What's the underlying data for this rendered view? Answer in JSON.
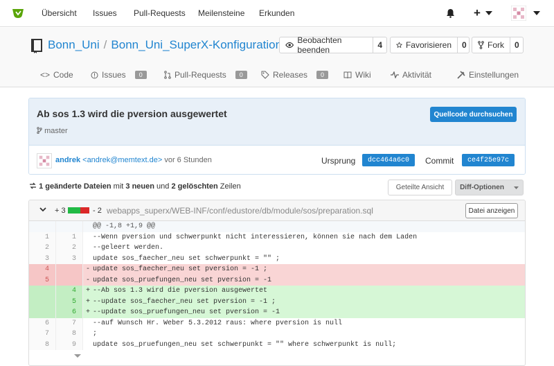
{
  "nav": {
    "items": [
      "Übersicht",
      "Issues",
      "Pull-Requests",
      "Meilensteine",
      "Erkunden"
    ],
    "plus_label": "+"
  },
  "repo": {
    "owner": "Bonn_Uni",
    "name": "Bonn_Uni_SuperX-Konfiguration",
    "watch_label": "Beobachten beenden",
    "watch_count": "4",
    "star_label": "Favorisieren",
    "star_count": "0",
    "fork_label": "Fork",
    "fork_count": "0"
  },
  "tabs": [
    {
      "label": "Code"
    },
    {
      "label": "Issues",
      "badge": "0"
    },
    {
      "label": "Pull-Requests",
      "badge": "0"
    },
    {
      "label": "Releases",
      "badge": "0"
    },
    {
      "label": "Wiki"
    },
    {
      "label": "Aktivität"
    },
    {
      "label": "Einstellungen"
    }
  ],
  "commit": {
    "title": "Ab sos 1.3 wird die pversion ausgewertet",
    "branch": "master",
    "browse_label": "Quellcode durchsuchen",
    "author_name": "andrek",
    "author_email": "<andrek@memtext.de>",
    "time": "vor 6 Stunden",
    "parent_label": "Ursprung",
    "parent_sha": "dcc464a6c0",
    "commit_label": "Commit",
    "commit_sha": "ce4f25e97c"
  },
  "stats": {
    "files": "1 geänderte Dateien",
    "mid1": " mit ",
    "added": "3 neuen",
    "mid2": " und ",
    "removed": "2 gelöschten",
    "tail": " Zeilen"
  },
  "buttons": {
    "split_label": "Geteilte Ansicht",
    "diff_options_label": "Diff-Optionen"
  },
  "file": {
    "additions": "+ 3",
    "deletions": "- 2",
    "path": "webapps_superx/WEB-INF/conf/edustore/db/module/sos/preparation.sql",
    "view_label": "Datei anzeigen"
  },
  "diff": [
    {
      "type": "hunk",
      "old": "",
      "new": "",
      "sign": "",
      "text": "@@ -1,8 +1,9 @@"
    },
    {
      "type": "ctx",
      "old": "1",
      "new": "1",
      "sign": "",
      "text": "--Wenn pversion und schwerpunkt nicht interessieren, können sie nach dem Laden"
    },
    {
      "type": "ctx",
      "old": "2",
      "new": "2",
      "sign": "",
      "text": "--geleert werden."
    },
    {
      "type": "ctx",
      "old": "3",
      "new": "3",
      "sign": "",
      "text": "update sos_faecher_neu set schwerpunkt = \"\" ;"
    },
    {
      "type": "del",
      "old": "4",
      "new": "",
      "sign": "-",
      "text": "update sos_faecher_neu set pversion = -1 ;"
    },
    {
      "type": "del",
      "old": "5",
      "new": "",
      "sign": "-",
      "text": "update sos_pruefungen_neu set pversion = -1"
    },
    {
      "type": "add",
      "old": "",
      "new": "4",
      "sign": "+",
      "text": "--Ab sos 1.3 wird die pversion ausgewertet"
    },
    {
      "type": "add",
      "old": "",
      "new": "5",
      "sign": "+",
      "text": "--update sos_faecher_neu set pversion = -1 ;"
    },
    {
      "type": "add",
      "old": "",
      "new": "6",
      "sign": "+",
      "text": "--update sos_pruefungen_neu set pversion = -1"
    },
    {
      "type": "ctx",
      "old": "6",
      "new": "7",
      "sign": "",
      "text": "--auf Wunsch Hr. Weber 5.3.2012 raus: where pversion is null"
    },
    {
      "type": "ctx",
      "old": "7",
      "new": "8",
      "sign": "",
      "text": ";"
    },
    {
      "type": "ctx",
      "old": "8",
      "new": "9",
      "sign": "",
      "text": "update sos_pruefungen_neu set schwerpunkt = \"\" where schwerpunkt is null;"
    }
  ],
  "colors": {
    "accent": "#2185d0",
    "add_bg": "#d6f7d6",
    "del_bg": "#f9d5d5",
    "logo": "#5aa509"
  }
}
